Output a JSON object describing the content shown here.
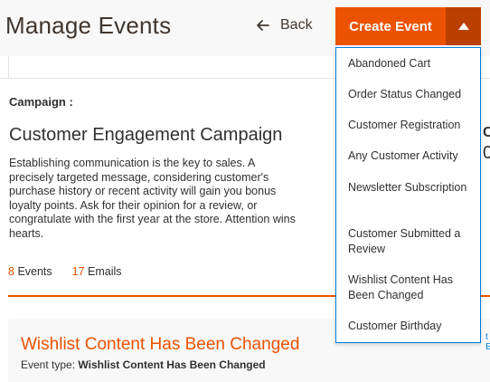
{
  "header": {
    "title": "Manage Events",
    "back_label": "Back",
    "create_label": "Create Event"
  },
  "dropdown": {
    "items": [
      "Abandoned Cart",
      "Order Status Changed",
      "Customer Registration",
      "Any Customer Activity",
      "Newsletter Subscription",
      "Customer Submitted a Review",
      "Wishlist Content Has Been Changed",
      "Customer Birthday"
    ]
  },
  "campaign": {
    "label": "Campaign :",
    "name": "Customer Engagement Campaign",
    "description": "Establishing communication is the key to sales. A precisely targeted message, considering customer's purchase history or recent activity will gain you bonus loyalty points. Ask for their opinion for a review, or congratulate with the first year at the store. Attention wins hearts.",
    "events_count": "8",
    "events_label": "Events",
    "emails_count": "17",
    "emails_label": "Emails"
  },
  "side_panel": {
    "heading_partial": "C",
    "value_partial": "0"
  },
  "event_card": {
    "title": "Wishlist Content Has Been Changed",
    "type_label": "Event type:",
    "type_value": "Wishlist Content Has Been Changed",
    "edge_link_partial": "t E"
  },
  "colors": {
    "accent": "#eb5202",
    "accent_dark": "#ba4000",
    "link": "#007bdb"
  }
}
